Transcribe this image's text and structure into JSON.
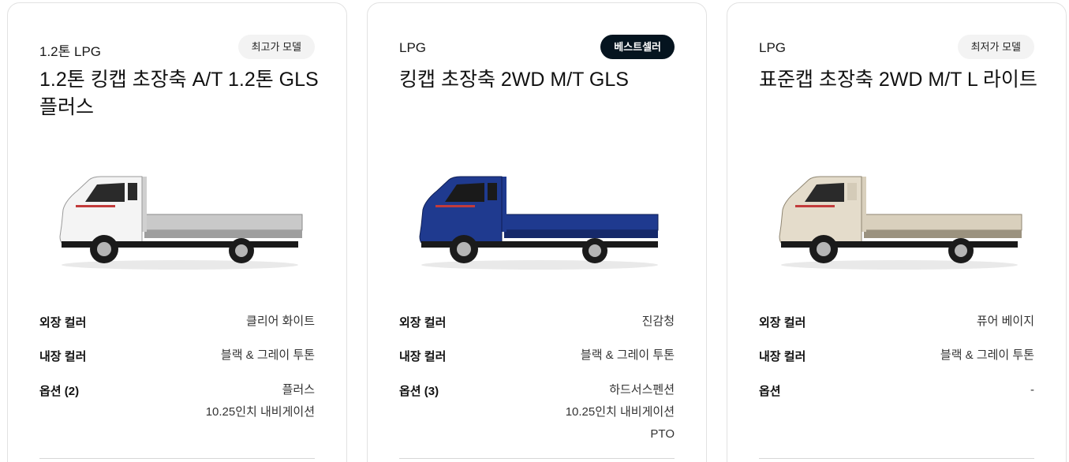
{
  "labels": {
    "exterior": "외장 컬러",
    "interior": "내장 컬러"
  },
  "cards": [
    {
      "fuel": "1.2톤 LPG",
      "badge": "최고가 모델",
      "title": "1.2톤 킹캡 초장축 A/T 1.2톤 GLS 플러스",
      "truck_color": "#f4f4f4",
      "exterior": "클리어 화이트",
      "interior": "블랙 & 그레이 투톤",
      "option_label": "옵션 (2)",
      "options": [
        "플러스",
        "10.25인치 내비게이션"
      ]
    },
    {
      "fuel": "LPG",
      "badge": "베스트셀러",
      "title": "킹캡 초장축 2WD M/T GLS",
      "truck_color": "#1f3a8f",
      "exterior": "진감청",
      "interior": "블랙 & 그레이 투톤",
      "option_label": "옵션 (3)",
      "options": [
        "하드서스펜션",
        "10.25인치 내비게이션",
        "PTO"
      ]
    },
    {
      "fuel": "LPG",
      "badge": "최저가 모델",
      "title": "표준캡 초장축 2WD M/T L 라이트",
      "truck_color": "#e4dccb",
      "exterior": "퓨어 베이지",
      "interior": "블랙 & 그레이 투톤",
      "option_label": "옵션",
      "options": [
        "-"
      ]
    }
  ],
  "colors": {
    "badge_dark": "#05141f",
    "badge_light": "#f3f3f3",
    "border": "#e2e2e2"
  }
}
